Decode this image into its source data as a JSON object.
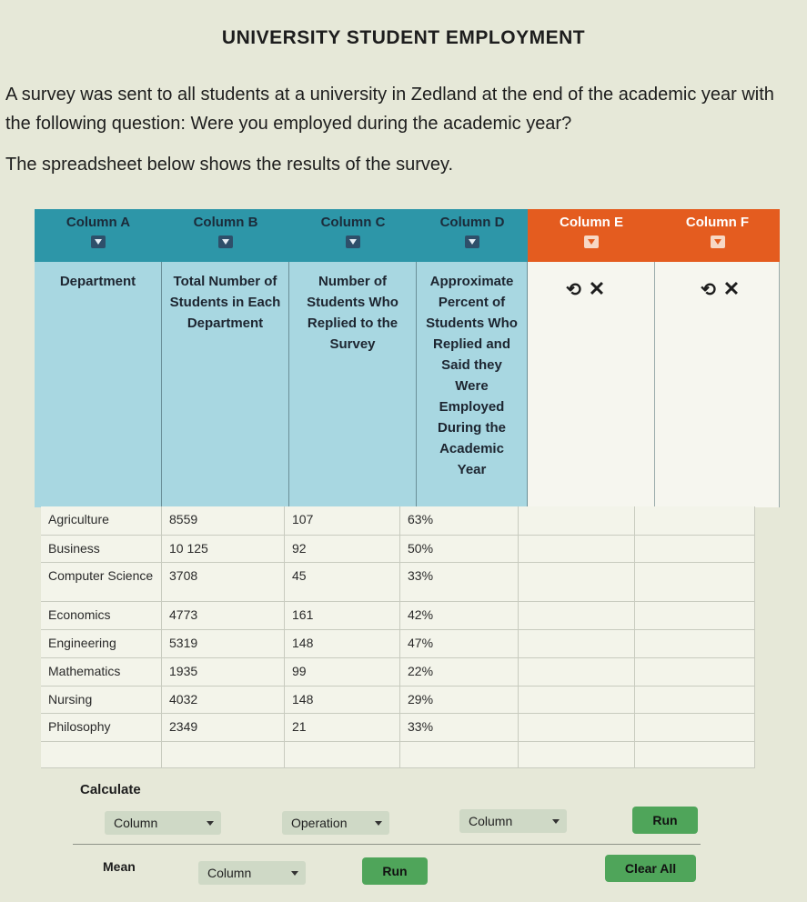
{
  "title": "UNIVERSITY STUDENT EMPLOYMENT",
  "intro": "A survey was sent to all students at a university in Zedland at the end of the academic year with the following question: Were you employed during the academic year?",
  "intro2": "The spreadsheet below shows the results of the survey.",
  "columns": [
    {
      "label": "Column A",
      "desc": "Department"
    },
    {
      "label": "Column B",
      "desc": "Total Number of Students in Each Department"
    },
    {
      "label": "Column C",
      "desc": "Number of Students Who Replied to the Survey"
    },
    {
      "label": "Column D",
      "desc": "Approximate Percent of Students Who Replied and Said they Were Employed During the Academic Year"
    },
    {
      "label": "Column E",
      "desc": ""
    },
    {
      "label": "Column F",
      "desc": ""
    }
  ],
  "colors": {
    "header_blue": "#2d96a8",
    "header_orange": "#e45c1f",
    "desc_blue": "#a8d7e1",
    "button_green": "#4fa55a"
  },
  "icons": {
    "dropdown": "chevron-down-icon",
    "undo": "undo-icon",
    "close": "close-icon"
  },
  "rows": [
    {
      "dept": "Agriculture",
      "total": "8559",
      "replied": "107",
      "percent": "63%"
    },
    {
      "dept": "Business",
      "total": "10 125",
      "replied": "92",
      "percent": "50%"
    },
    {
      "dept": "Computer Science",
      "total": "3708",
      "replied": "45",
      "percent": "33%"
    },
    {
      "dept": "Economics",
      "total": "4773",
      "replied": "161",
      "percent": "42%"
    },
    {
      "dept": "Engineering",
      "total": "5319",
      "replied": "148",
      "percent": "47%"
    },
    {
      "dept": "Mathematics",
      "total": "1935",
      "replied": "99",
      "percent": "22%"
    },
    {
      "dept": "Nursing",
      "total": "4032",
      "replied": "148",
      "percent": "29%"
    },
    {
      "dept": "Philosophy",
      "total": "2349",
      "replied": "21",
      "percent": "33%"
    }
  ],
  "calculate": {
    "label": "Calculate",
    "column1": "Column",
    "operation": "Operation",
    "column2": "Column",
    "run": "Run"
  },
  "mean": {
    "label": "Mean",
    "column": "Column",
    "run": "Run",
    "clear": "Clear All"
  }
}
